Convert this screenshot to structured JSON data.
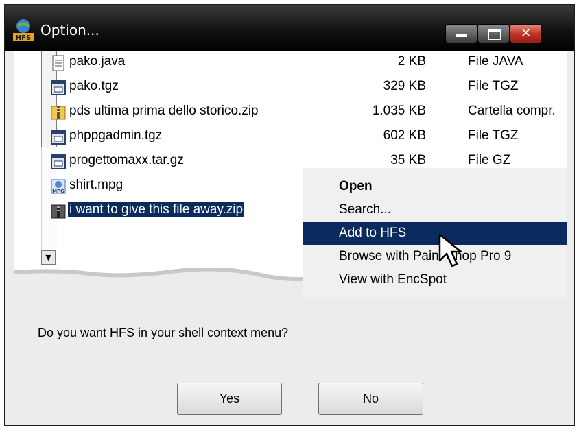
{
  "window": {
    "title": "Option...",
    "app_icon_label": "HFS"
  },
  "files": [
    {
      "name": "pako.java",
      "size": "2 KB",
      "type": "File JAVA",
      "icon": "text-file-icon"
    },
    {
      "name": "pako.tgz",
      "size": "329 KB",
      "type": "File TGZ",
      "icon": "archive-file-icon"
    },
    {
      "name": "pds ultima prima dello storico.zip",
      "size": "1.035 KB",
      "type": "Cartella compr.",
      "icon": "zip-folder-icon"
    },
    {
      "name": "phppgadmin.tgz",
      "size": "602 KB",
      "type": "File TGZ",
      "icon": "archive-file-icon"
    },
    {
      "name": "progettomaxx.tar.gz",
      "size": "35 KB",
      "type": "File GZ",
      "icon": "archive-file-icon"
    },
    {
      "name": "shirt.mpg",
      "size": "",
      "type": "",
      "icon": "video-file-icon"
    },
    {
      "name": "i want to give this file away.zip",
      "size": "",
      "type": "",
      "icon": "zip-folder-icon"
    }
  ],
  "context_menu": {
    "items": [
      {
        "label": "Open"
      },
      {
        "label": "Search..."
      },
      {
        "label": "Add to HFS"
      },
      {
        "label": "Browse with Paint Shop Pro 9"
      },
      {
        "label": "View with EncSpot"
      }
    ]
  },
  "dialog": {
    "message": "Do you want HFS in your shell context menu?",
    "yes_label": "Yes",
    "no_label": "No"
  },
  "colors": {
    "selection": "#0b2b5e",
    "titlebar": "#121212",
    "close_button": "#c0352a"
  }
}
